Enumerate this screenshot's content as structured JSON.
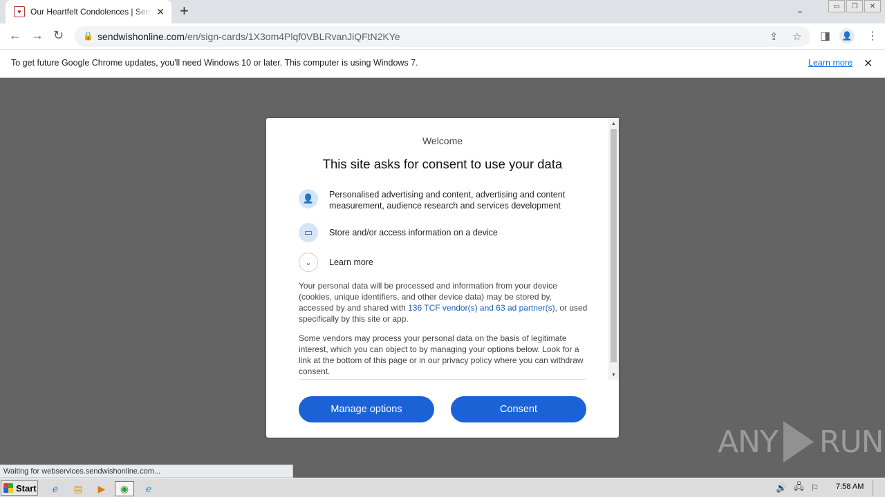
{
  "browser": {
    "tab": {
      "title": "Our Heartfelt Condolences | Sendwishonline",
      "favicon_glyph": "♥",
      "close_glyph": "✕"
    },
    "new_tab_glyph": "+",
    "tab_search_glyph": "⌄",
    "window_buttons": [
      "▭",
      "❐",
      "✕"
    ],
    "nav": {
      "back": "←",
      "forward": "→",
      "reload": "↻"
    },
    "lock_glyph": "🔒",
    "url": {
      "domain": "sendwishonline.com",
      "path": "/en/sign-cards/1X3om4Plqf0VBLRvanJiQFtN2KYe"
    },
    "omnibox_icons": {
      "share": "⇪",
      "bookmark": "☆"
    },
    "toolbar_icons": {
      "side_panel": "◨",
      "profile": "👤",
      "menu": "⋮"
    }
  },
  "infobar": {
    "message": "To get future Google Chrome updates, you'll need Windows 10 or later. This computer is using Windows 7.",
    "link": "Learn more",
    "close_glyph": "✕"
  },
  "consent": {
    "welcome": "Welcome",
    "heading": "This site asks for consent to use your data",
    "purposes": [
      {
        "icon": "person-icon",
        "glyph": "👤",
        "text": "Personalised advertising and content, advertising and content measurement, audience research and services development"
      },
      {
        "icon": "device-icon",
        "glyph": "▭",
        "text": "Store and/or access information on a device"
      }
    ],
    "learn_more": {
      "glyph": "⌄",
      "label": "Learn more"
    },
    "paragraph1_before": "Your personal data will be processed and information from your device (cookies, unique identifiers, and other device data) may be stored by, accessed by and shared with ",
    "paragraph1_link": "136 TCF vendor(s) and 63 ad partner(s)",
    "paragraph1_after": ", or used specifically by this site or app.",
    "paragraph2": "Some vendors may process your personal data on the basis of legitimate interest, which you can object to by managing your options below. Look for a link at the bottom of this page or in our privacy policy where you can withdraw consent.",
    "buttons": {
      "manage": "Manage options",
      "consent": "Consent"
    },
    "scroll_up": "▲",
    "scroll_down": "▼"
  },
  "status_bar": "Waiting for webservices.sendwishonline.com...",
  "watermark": {
    "left": "ANY",
    "right": "RUN"
  },
  "taskbar": {
    "start": "Start",
    "apps": [
      {
        "name": "ie-icon",
        "glyph": "ℯ",
        "color": "#1e7fd8"
      },
      {
        "name": "explorer-icon",
        "glyph": "▤",
        "color": "#d9a520"
      },
      {
        "name": "media-player-icon",
        "glyph": "▶",
        "color": "#e07b14"
      },
      {
        "name": "chrome-icon",
        "glyph": "◉",
        "color": "#2b9e3f"
      },
      {
        "name": "edge-icon",
        "glyph": "ℯ",
        "color": "#1b8fd6"
      }
    ],
    "tray": [
      "🔊",
      "🖧",
      "⚐"
    ],
    "clock": "7:58 AM"
  },
  "colors": {
    "accent_button": "#1a62d6",
    "link": "#1a73e8",
    "backdrop": "#646464"
  }
}
